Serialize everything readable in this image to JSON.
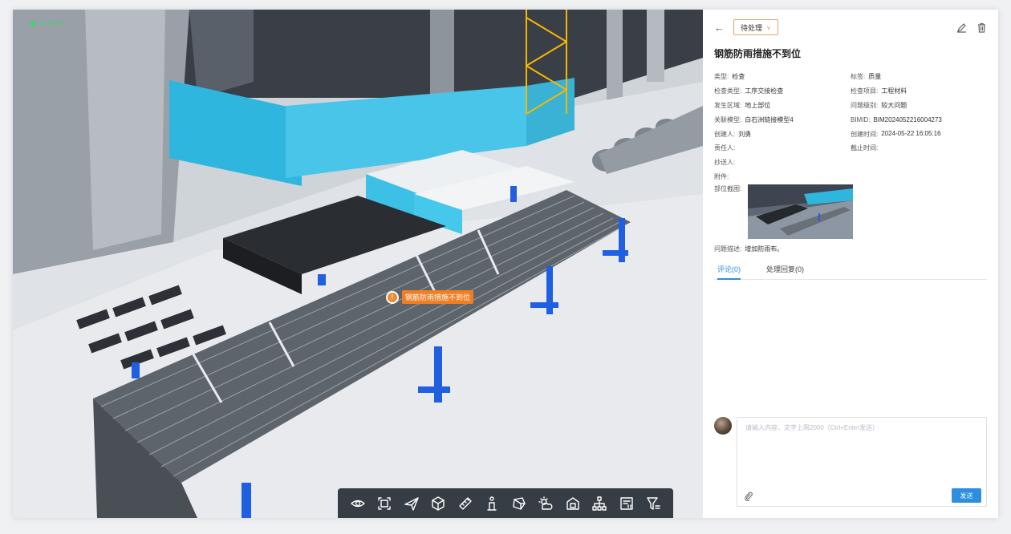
{
  "viewport": {
    "fps_label": "21.00 ms",
    "marker_label": "钢筋防雨措施不到位",
    "toolbar_icons": [
      "eye-icon",
      "section-box-icon",
      "send-icon",
      "model-cube-icon",
      "measure-ruler-icon",
      "person-roam-icon",
      "3d-object-icon",
      "weather-icon",
      "view-box-icon",
      "hierarchy-tree-icon",
      "properties-icon",
      "filter-icon"
    ]
  },
  "panel": {
    "status": "待处理",
    "title": "钢筋防雨措施不到位",
    "fields": {
      "type_label": "类型:",
      "type_value": "检查",
      "tag_label": "标签:",
      "tag_value": "质量",
      "check_type_label": "检查类型:",
      "check_type_value": "工序交接检查",
      "check_item_label": "检查项目:",
      "check_item_value": "工程材料",
      "area_label": "发生区域:",
      "area_value": "地上部位",
      "level_label": "问题级别:",
      "level_value": "较大问题",
      "model_label": "关联模型:",
      "model_value": "白石洲链接模型4",
      "bimid_label": "BIMID:",
      "bimid_value": "BIM2024052216004273",
      "creator_label": "创建人:",
      "creator_value": "刘勇",
      "created_label": "创建时间:",
      "created_value": "2024-05-22 16:05:16",
      "owner_label": "责任人:",
      "deadline_label": "截止时间:",
      "cc_label": "抄送人:",
      "attach_label": "附件:",
      "snapshot_label": "部位截图:",
      "desc_label": "问题描述:",
      "desc_value": "增加防雨布。"
    },
    "tabs": {
      "comments": "评论(0)",
      "replies": "处理回复(0)"
    },
    "comment": {
      "placeholder": "请输入内容，文字上限2000（Ctrl+Enter发送）",
      "send_label": "发送"
    }
  },
  "colors": {
    "accent": "#2b8ee0",
    "status_border": "#e8a062",
    "marker": "#f07e22"
  }
}
